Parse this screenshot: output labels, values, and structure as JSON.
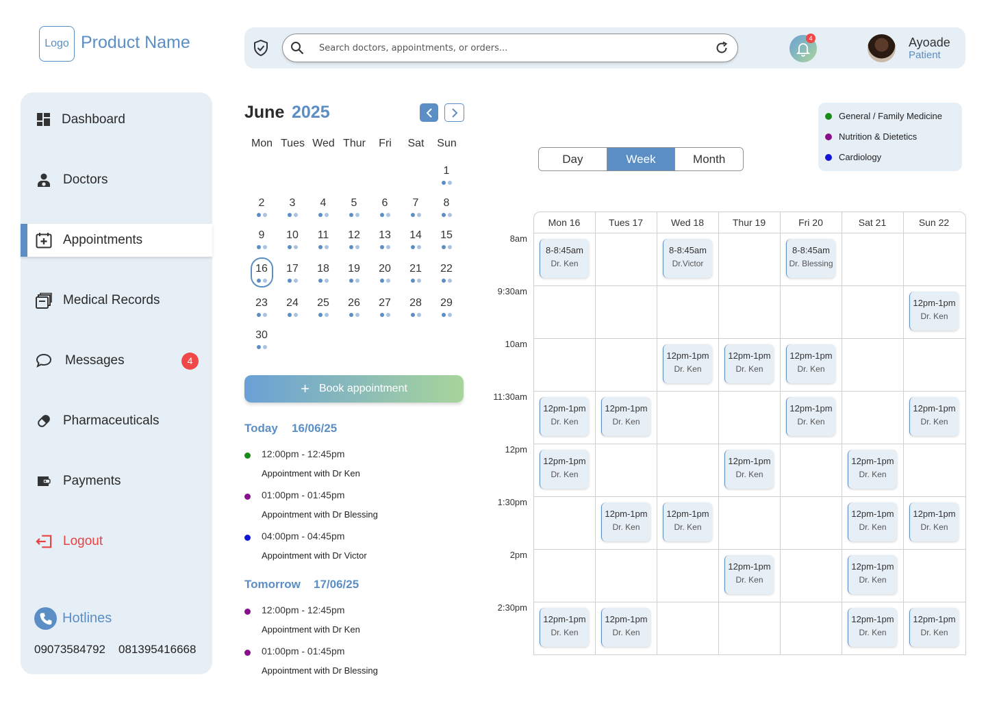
{
  "brand": {
    "logo": "Logo",
    "product": "Product Name"
  },
  "header": {
    "search_placeholder": "Search doctors, appointments, or orders...",
    "notif_count": "4",
    "user_name": "Ayoade",
    "user_role": "Patient"
  },
  "sidebar": {
    "items": [
      {
        "label": "Dashboard",
        "icon": "dashboard-icon"
      },
      {
        "label": "Doctors",
        "icon": "doctor-icon"
      },
      {
        "label": "Appointments",
        "icon": "calendar-plus-icon"
      },
      {
        "label": "Medical Records",
        "icon": "records-icon"
      },
      {
        "label": "Messages",
        "icon": "chat-icon"
      },
      {
        "label": "Pharmaceuticals",
        "icon": "pill-icon"
      },
      {
        "label": "Payments",
        "icon": "wallet-icon"
      },
      {
        "label": "Logout",
        "icon": "logout-icon"
      }
    ],
    "messages_badge": "4",
    "hotlines_title": "Hotlines",
    "hotline1": "09073584792",
    "hotline2": "081395416668"
  },
  "calendar": {
    "month": "June",
    "year": "2025",
    "weekdays": [
      "Mon",
      "Tues",
      "Wed",
      "Thur",
      "Fri",
      "Sat",
      "Sun"
    ],
    "weeks": [
      [
        "",
        "",
        "",
        "",
        "",
        "",
        "1"
      ],
      [
        "2",
        "3",
        "4",
        "5",
        "6",
        "7",
        "8"
      ],
      [
        "9",
        "10",
        "11",
        "12",
        "13",
        "14",
        "15"
      ],
      [
        "16",
        "17",
        "18",
        "19",
        "20",
        "21",
        "22"
      ],
      [
        "23",
        "24",
        "25",
        "26",
        "27",
        "28",
        "29"
      ],
      [
        "30",
        "",
        "",
        "",
        "",
        "",
        ""
      ]
    ],
    "selected": "16"
  },
  "book_label": "Book appointment",
  "agenda": [
    {
      "day": "Today",
      "date": "16/06/25",
      "items": [
        {
          "time": "12:00pm - 12:45pm",
          "desc": "Appointment with Dr Ken",
          "color": "#1a8a1a"
        },
        {
          "time": "01:00pm - 01:45pm",
          "desc": "Appointment with Dr Blessing",
          "color": "#8a0f8a"
        },
        {
          "time": "04:00pm - 04:45pm",
          "desc": "Appointment with Dr Victor",
          "color": "#1414d6"
        }
      ]
    },
    {
      "day": "Tomorrow",
      "date": "17/06/25",
      "items": [
        {
          "time": "12:00pm - 12:45pm",
          "desc": "Appointment with Dr Ken",
          "color": "#8a0f8a"
        },
        {
          "time": "01:00pm - 01:45pm",
          "desc": "Appointment with Dr Blessing",
          "color": "#8a0f8a"
        }
      ]
    }
  ],
  "legend": [
    {
      "label": "General / Family Medicine",
      "color": "#1a8a1a"
    },
    {
      "label": "Nutrition & Dietetics",
      "color": "#8a0f8a"
    },
    {
      "label": "Cardiology",
      "color": "#1414d6"
    }
  ],
  "view_toggle": {
    "options": [
      "Day",
      "Week",
      "Month"
    ],
    "selected": "Week"
  },
  "week": {
    "days": [
      "Mon 16",
      "Tues 17",
      "Wed 18",
      "Thur 19",
      "Fri 20",
      "Sat 21",
      "Sun 22"
    ],
    "times": [
      "8am",
      "9:30am",
      "10am",
      "11:30am",
      "12pm",
      "1:30pm",
      "2pm",
      "2:30pm"
    ],
    "events": [
      {
        "row": 0,
        "col": 0,
        "time": "8-8:45am",
        "doc": "Dr. Ken"
      },
      {
        "row": 0,
        "col": 2,
        "time": "8-8:45am",
        "doc": "Dr.Victor"
      },
      {
        "row": 0,
        "col": 4,
        "time": "8-8:45am",
        "doc": "Dr. Blessing"
      },
      {
        "row": 1,
        "col": 6,
        "time": "12pm-1pm",
        "doc": "Dr. Ken"
      },
      {
        "row": 2,
        "col": 2,
        "time": "12pm-1pm",
        "doc": "Dr. Ken"
      },
      {
        "row": 2,
        "col": 3,
        "time": "12pm-1pm",
        "doc": "Dr. Ken"
      },
      {
        "row": 2,
        "col": 4,
        "time": "12pm-1pm",
        "doc": "Dr. Ken"
      },
      {
        "row": 3,
        "col": 0,
        "time": "12pm-1pm",
        "doc": "Dr. Ken"
      },
      {
        "row": 3,
        "col": 1,
        "time": "12pm-1pm",
        "doc": "Dr. Ken"
      },
      {
        "row": 3,
        "col": 4,
        "time": "12pm-1pm",
        "doc": "Dr. Ken"
      },
      {
        "row": 3,
        "col": 6,
        "time": "12pm-1pm",
        "doc": "Dr. Ken"
      },
      {
        "row": 4,
        "col": 0,
        "time": "12pm-1pm",
        "doc": "Dr. Ken"
      },
      {
        "row": 4,
        "col": 3,
        "time": "12pm-1pm",
        "doc": "Dr. Ken"
      },
      {
        "row": 4,
        "col": 5,
        "time": "12pm-1pm",
        "doc": "Dr. Ken"
      },
      {
        "row": 5,
        "col": 1,
        "time": "12pm-1pm",
        "doc": "Dr. Ken"
      },
      {
        "row": 5,
        "col": 2,
        "time": "12pm-1pm",
        "doc": "Dr. Ken"
      },
      {
        "row": 5,
        "col": 5,
        "time": "12pm-1pm",
        "doc": "Dr. Ken"
      },
      {
        "row": 5,
        "col": 6,
        "time": "12pm-1pm",
        "doc": "Dr. Ken"
      },
      {
        "row": 6,
        "col": 3,
        "time": "12pm-1pm",
        "doc": "Dr. Ken"
      },
      {
        "row": 6,
        "col": 5,
        "time": "12pm-1pm",
        "doc": "Dr. Ken"
      },
      {
        "row": 7,
        "col": 0,
        "time": "12pm-1pm",
        "doc": "Dr. Ken"
      },
      {
        "row": 7,
        "col": 1,
        "time": "12pm-1pm",
        "doc": "Dr. Ken"
      },
      {
        "row": 7,
        "col": 5,
        "time": "12pm-1pm",
        "doc": "Dr. Ken"
      },
      {
        "row": 7,
        "col": 6,
        "time": "12pm-1pm",
        "doc": "Dr. Ken"
      }
    ]
  }
}
